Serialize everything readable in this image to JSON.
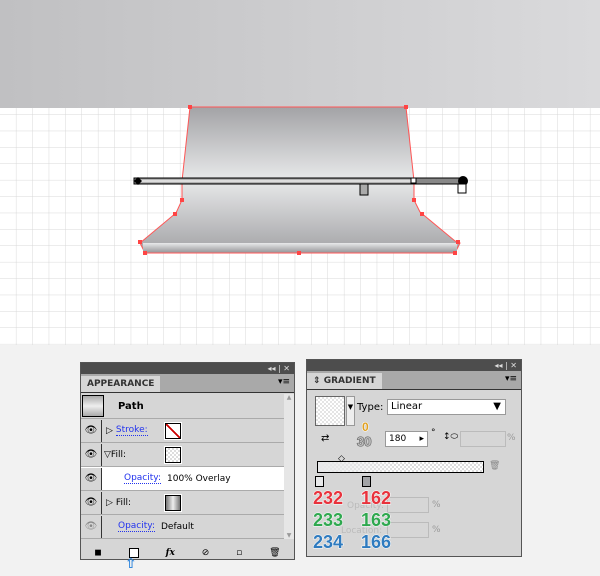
{
  "appearance": {
    "tab": "APPEARANCE",
    "object": "Path",
    "rows": [
      {
        "label": "Stroke:",
        "value": ""
      },
      {
        "label": "Fill:",
        "value": ""
      },
      {
        "label": "Opacity:",
        "value": "100% Overlay"
      },
      {
        "label": "Fill:",
        "value": ""
      },
      {
        "label": "Opacity:",
        "value": "Default"
      }
    ],
    "footer_icons": [
      "add-new-stroke-icon",
      "add-new-fill-icon",
      "fx-icon",
      "clear-icon",
      "duplicate-icon",
      "delete-icon"
    ],
    "fx": "fx"
  },
  "gradient": {
    "tab": "GRADIENT",
    "type_label": "Type:",
    "type_value": "Linear",
    "angle": "180",
    "degree": "°",
    "percent": "%",
    "opacity_label": "Opacity:",
    "location_label": "Location:",
    "annotation_top": "0",
    "annotation_bottom": "30",
    "stops": [
      {
        "r": "232",
        "g": "233",
        "b": "234"
      },
      {
        "r": "162",
        "g": "163",
        "b": "166"
      }
    ]
  },
  "colors": {
    "red": "#e8323c",
    "green": "#2fa84f",
    "blue": "#2f7bbf"
  }
}
